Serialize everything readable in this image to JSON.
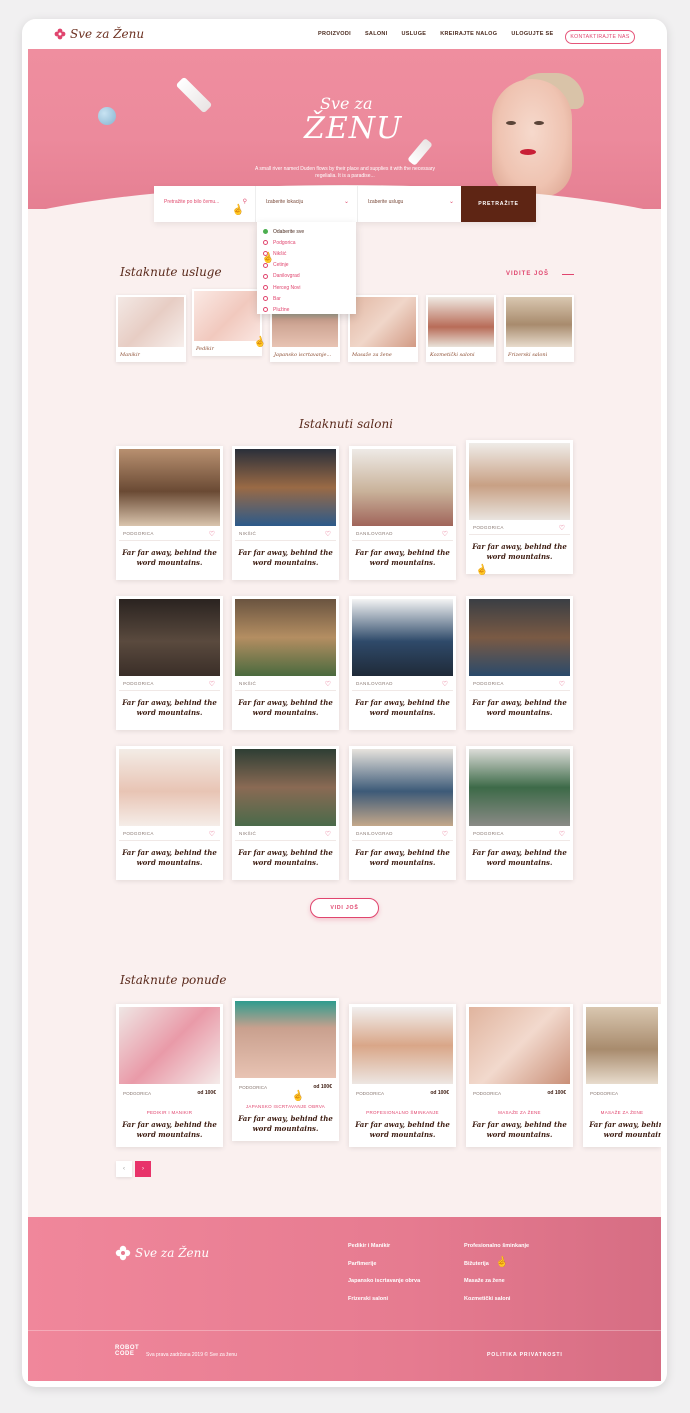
{
  "brand": {
    "name": "Sve za Ženu"
  },
  "nav": {
    "links": [
      "PROIZVODI",
      "SALONI",
      "USLUGE",
      "KREIRAJTE NALOG",
      "ULOGUJTE SE"
    ],
    "contact": "KONTAKTIRAJTE NAS"
  },
  "hero": {
    "title_line1": "Sve za",
    "title_line2": "ŽENU",
    "description": "A small river named Duden flows by their place and supplies it with the necessary regelialia. It is a paradise..."
  },
  "search": {
    "query_placeholder": "Pretražite po bilo čemu...",
    "location_label": "Izaberite lokaciju",
    "service_label": "Izaberite uslugu",
    "button": "PRETRAŽITE",
    "location_options": [
      "Odaberite sve",
      "Podgorica",
      "Nikšić",
      "Cetinje",
      "Danilovgrad",
      "Herceg Novi",
      "Bar",
      "Plužine"
    ]
  },
  "featured_services": {
    "title": "Istaknute usluge",
    "see_more": "VIDITE JOŠ",
    "items": [
      "Manikir",
      "Pedikir",
      "Japansko iscrtavanje...",
      "Masaže za žene",
      "Kozmetički saloni",
      "Frizerski saloni"
    ]
  },
  "featured_salons": {
    "title": "Istaknuti saloni",
    "more_button": "VIDI JOŠ",
    "items": [
      {
        "city": "PODGORICA",
        "desc": "Far far away, behind the word mountains."
      },
      {
        "city": "NIKŠIĆ",
        "desc": "Far far away, behind the word mountains."
      },
      {
        "city": "DANILOVGRAD",
        "desc": "Far far away, behind the word mountains."
      },
      {
        "city": "PODGORICA",
        "desc": "Far far away, behind the word mountains."
      },
      {
        "city": "PODGORICA",
        "desc": "Far far away, behind the word mountains."
      },
      {
        "city": "NIKŠIĆ",
        "desc": "Far far away, behind the word mountains."
      },
      {
        "city": "DANILOVGRAD",
        "desc": "Far far away, behind the word mountains."
      },
      {
        "city": "PODGORICA",
        "desc": "Far far away, behind the word mountains."
      },
      {
        "city": "PODGORICA",
        "desc": "Far far away, behind the word mountains."
      },
      {
        "city": "NIKŠIĆ",
        "desc": "Far far away, behind the word mountains."
      },
      {
        "city": "DANILOVGRAD",
        "desc": "Far far away, behind the word mountains."
      },
      {
        "city": "PODGORICA",
        "desc": "Far far away, behind the word mountains."
      }
    ]
  },
  "featured_offers": {
    "title": "Istaknute ponude",
    "items": [
      {
        "city": "PODGORICA",
        "price": "od 100€",
        "category": "PEDIKIR I MANIKIR",
        "desc": "Far far away, behind the word mountains."
      },
      {
        "city": "PODGORICA",
        "price": "od 100€",
        "category": "JAPANSKO ISCRTAVANJE OBRVA",
        "desc": "Far far away, behind the word mountains."
      },
      {
        "city": "PODGORICA",
        "price": "od 100€",
        "category": "PROFESIONALNO ŠMINKANJE",
        "desc": "Far far away, behind the word mountains."
      },
      {
        "city": "PODGORICA",
        "price": "od 100€",
        "category": "MASAŽE ZA ŽENE",
        "desc": "Far far away, behind the word mountains."
      },
      {
        "city": "PODGORICA",
        "price": "",
        "category": "MASAŽE ZA ŽENE",
        "desc": "Far far away, behind the word mountains."
      }
    ],
    "prev": "‹",
    "next": "›"
  },
  "footer": {
    "col1": [
      "Pedikir i Manikir",
      "Parfimerije",
      "Japansko iscrtavanje obrva",
      "Frizerski saloni"
    ],
    "col2": [
      "Profesionalno šminkanje",
      "Bižuterija",
      "Masaže za žene",
      "Kozmetički saloni"
    ],
    "robot_line1": "ROBOT",
    "robot_line2": "CODE",
    "copyright": "Sva prava zadržana 2019 © Sve za ženu",
    "policy": "POLITIKA PRIVATNOSTI"
  },
  "colors": {
    "accent": "#e0456e",
    "brown": "#5e2514",
    "hero": "#ec8a9c",
    "bg": "#faf0ef"
  },
  "icons": [
    "flower-logo-icon",
    "search-icon",
    "chevron-down-icon",
    "heart-icon",
    "arrow-right-icon",
    "cursor-hand-icon"
  ]
}
